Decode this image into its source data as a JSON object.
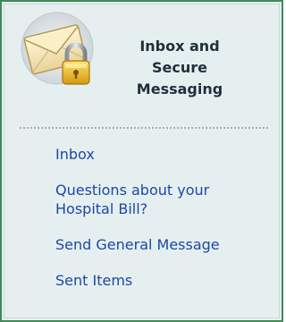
{
  "header": {
    "title": "Inbox and\nSecure\nMessaging",
    "icon": "envelope-with-padlock-icon"
  },
  "menu": {
    "items": [
      {
        "label": "Inbox"
      },
      {
        "label": "Questions about your Hospital Bill?"
      },
      {
        "label": "Send General Message"
      },
      {
        "label": "Sent Items"
      }
    ]
  },
  "colors": {
    "panel_background": "#e6eff0",
    "panel_border": "#3f8a57",
    "link": "#1c47a8",
    "title": "#1f2f3b",
    "divider": "#a7b0b2"
  }
}
